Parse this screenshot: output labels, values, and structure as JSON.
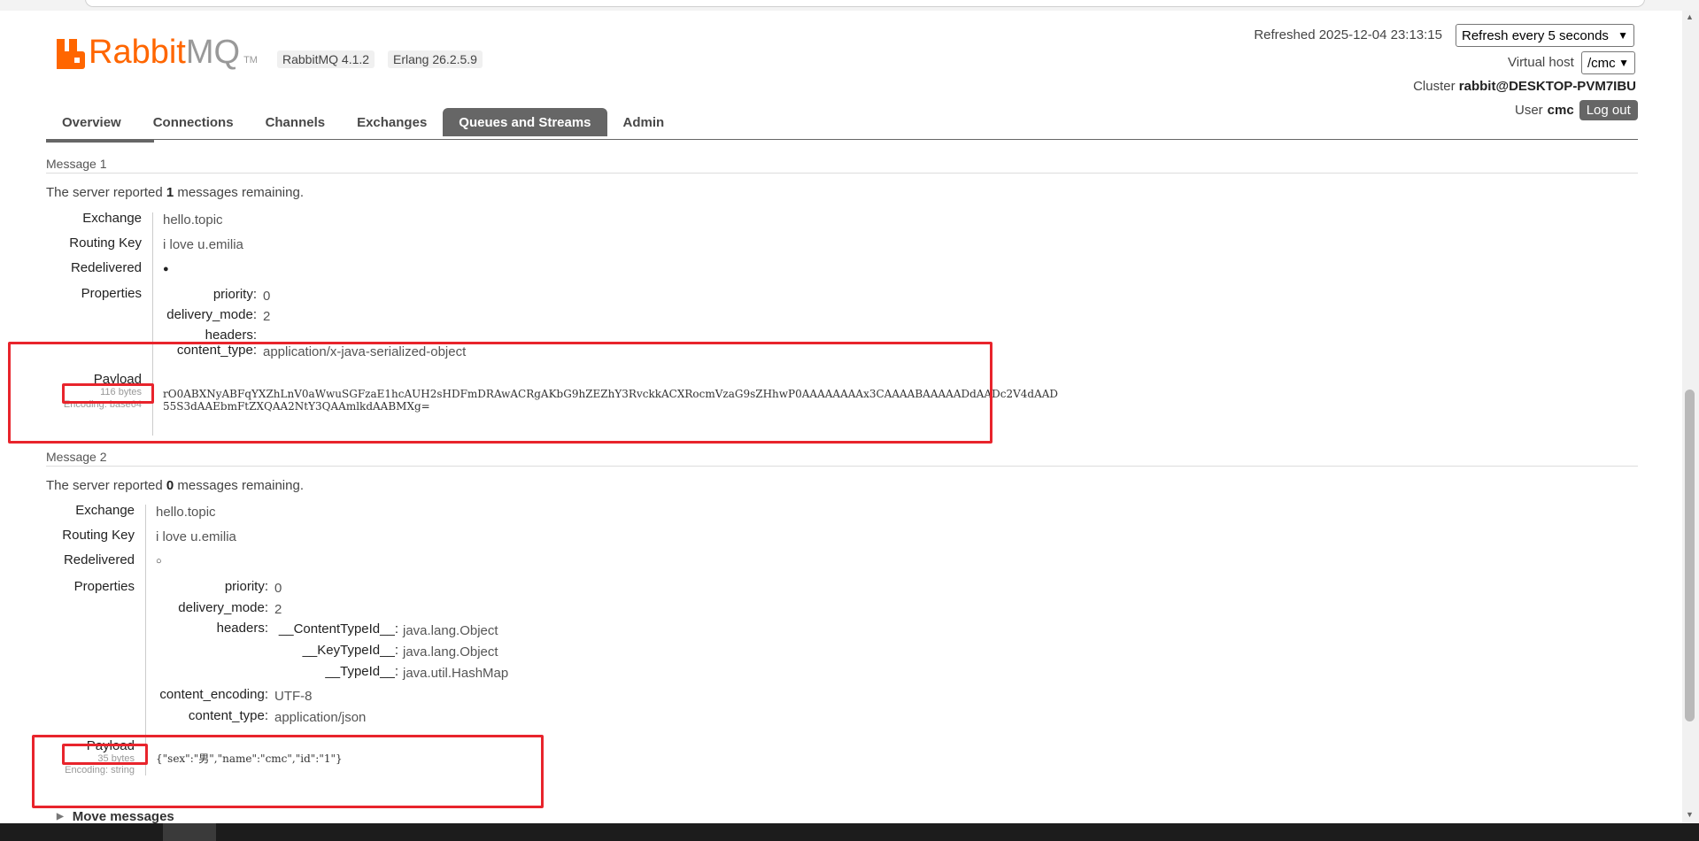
{
  "header": {
    "logo_rabbit": "Rabbit",
    "logo_mq": "MQ",
    "logo_tm": "TM",
    "rabbitmq_version": "RabbitMQ 4.1.2",
    "erlang_version": "Erlang 26.2.5.9",
    "refreshed": "Refreshed 2025-12-04 23:13:15",
    "refresh_select": "Refresh every 5 seconds",
    "vhost_label": "Virtual host",
    "vhost_select": "/cmc",
    "cluster_label": "Cluster",
    "cluster_name": "rabbit@DESKTOP-PVM7IBU",
    "user_label": "User",
    "user_name": "cmc",
    "logout": "Log out"
  },
  "tabs": [
    "Overview",
    "Connections",
    "Channels",
    "Exchanges",
    "Queues and Streams",
    "Admin"
  ],
  "active_tab": "Queues and Streams",
  "messages": [
    {
      "title": "Message 1",
      "reported_pre": "The server reported ",
      "reported_count": "1",
      "reported_post": " messages remaining.",
      "exchange_label": "Exchange",
      "exchange": "hello.topic",
      "routing_key_label": "Routing Key",
      "routing_key": "i love u.emilia",
      "redelivered_label": "Redelivered",
      "redelivered": "●",
      "properties_label": "Properties",
      "properties": {
        "priority_k": "priority:",
        "priority": "0",
        "delivery_mode_k": "delivery_mode:",
        "delivery_mode": "2",
        "headers_k": "headers:",
        "content_type_k": "content_type:",
        "content_type": "application/x-java-serialized-object"
      },
      "payload_label": "Payload",
      "payload_bytes": "116 bytes",
      "payload_encoding": "Encoding: base64",
      "payload_line1": "rO0ABXNyABFqYXZhLnV0aWwuSGFzaE1hcAUH2sHDFmDRAwACRgAKbG9hZEZhY3RvckkACXRocmVzaG9sZHhwP0AAAAAAAAx3CAAAABAAAAADdAADc2V4dAAD",
      "payload_line2": "55S3dAAEbmFtZXQAA2NtY3QAAmlkdAABMXg="
    },
    {
      "title": "Message 2",
      "reported_pre": "The server reported ",
      "reported_count": "0",
      "reported_post": " messages remaining.",
      "exchange_label": "Exchange",
      "exchange": "hello.topic",
      "routing_key_label": "Routing Key",
      "routing_key": "i love u.emilia",
      "redelivered_label": "Redelivered",
      "redelivered": "○",
      "properties_label": "Properties",
      "properties": {
        "priority_k": "priority:",
        "priority": "0",
        "delivery_mode_k": "delivery_mode:",
        "delivery_mode": "2",
        "headers_k": "headers:",
        "h1_k": "__ContentTypeId__:",
        "h1": "java.lang.Object",
        "h2_k": "__KeyTypeId__:",
        "h2": "java.lang.Object",
        "h3_k": "__TypeId__:",
        "h3": "java.util.HashMap",
        "content_encoding_k": "content_encoding:",
        "content_encoding": "UTF-8",
        "content_type_k": "content_type:",
        "content_type": "application/json"
      },
      "payload_label": "Payload",
      "payload_bytes": "35 bytes",
      "payload_encoding": "Encoding: string",
      "payload_line1": "{\"sex\":\"男\",\"name\":\"cmc\",\"id\":\"1\"}"
    }
  ],
  "move_messages": "Move messages",
  "colors": {
    "brand": "#ff6600",
    "tab_active": "#666666",
    "highlight": "#e8242c"
  }
}
